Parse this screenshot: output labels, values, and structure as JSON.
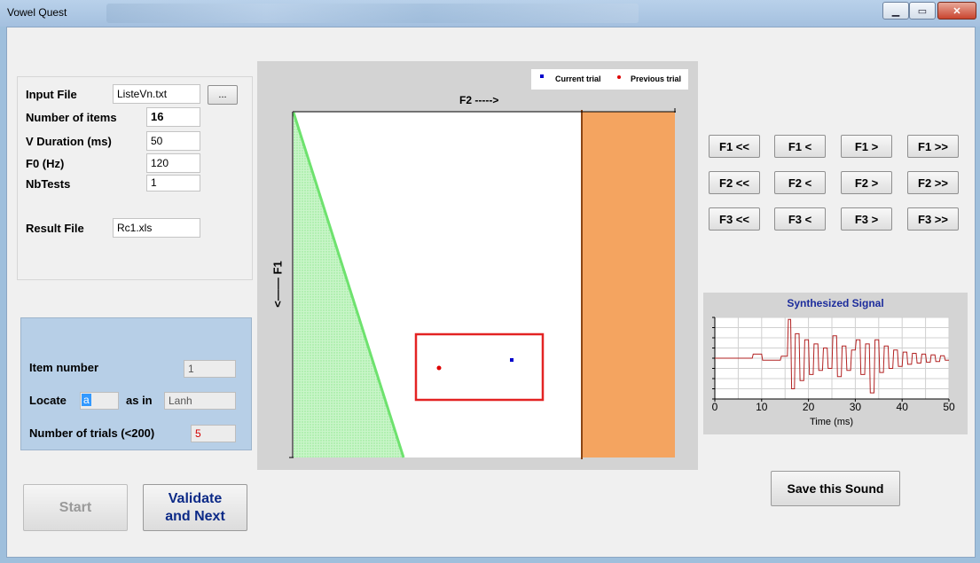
{
  "window": {
    "title": "Vowel Quest",
    "minimize_icon": "minimize-icon",
    "maximize_icon": "maximize-icon",
    "close_icon": "close-icon"
  },
  "inputs": {
    "input_file_label": "Input File",
    "input_file_value": "ListeVn.txt",
    "browse_label": "...",
    "num_items_label": "Number of items",
    "num_items_value": "16",
    "v_duration_label": "V Duration (ms)",
    "v_duration_value": "50",
    "f0_label": "F0 (Hz)",
    "f0_value": "120",
    "nbtests_label": "NbTests",
    "nbtests_value": "1",
    "result_file_label": "Result File",
    "result_file_value": "Rc1.xls"
  },
  "item": {
    "item_number_label": "Item number",
    "item_number_value": "1",
    "locate_label": "Locate",
    "locate_value": "a",
    "as_in_label": "as in",
    "as_in_value": "Lanh",
    "trials_label": "Number of trials (<200)",
    "trials_value": "5"
  },
  "buttons": {
    "start": "Start",
    "validate_line1": "Validate",
    "validate_line2": "and Next",
    "save_sound": "Save this Sound"
  },
  "plot": {
    "f2_label": "F2 ----->",
    "f1_label": "<—— F1",
    "legend_current": "Current trial",
    "legend_previous": "Previous trial",
    "current_color": "#0000cc",
    "previous_color": "#dd0000"
  },
  "formant_buttons": [
    [
      "F1 <<",
      "F1 <",
      "F1 >",
      "F1 >>"
    ],
    [
      "F2 <<",
      "F2 <",
      "F2 >",
      "F2 >>"
    ],
    [
      "F3 <<",
      "F3 <",
      "F3 >",
      "F3 >>"
    ]
  ],
  "signal": {
    "title": "Synthesized Signal",
    "xlabel": "Time (ms)",
    "xticks": [
      "0",
      "10",
      "20",
      "30",
      "40",
      "50"
    ]
  },
  "chart_data": {
    "type": "line",
    "title": "Synthesized Signal",
    "xlabel": "Time (ms)",
    "ylabel": "",
    "xlim": [
      0,
      50
    ],
    "ylim": [
      -1,
      1
    ],
    "series": [
      {
        "x": [
          0,
          8,
          8.2,
          10,
          10.2,
          14,
          14.2,
          15.5,
          15.7,
          16.2,
          16.4,
          17,
          17.2,
          18,
          18.2,
          19,
          19.2,
          20,
          20.2,
          21,
          21.2,
          22,
          22.2,
          23,
          23.2,
          24,
          24.2,
          25,
          25.2,
          26,
          26.2,
          27,
          27.2,
          28,
          28.2,
          29,
          29.2,
          30,
          30.2,
          31,
          31.2,
          32,
          32.2,
          33,
          33.2,
          34,
          34.2,
          35,
          35.2,
          36,
          36.2,
          37,
          37.2,
          38,
          38.2,
          39,
          39.2,
          40,
          40.2,
          41,
          41.2,
          42,
          42.2,
          43,
          43.2,
          44,
          44.2,
          45,
          45.2,
          46,
          46.2,
          47,
          47.2,
          48,
          48.2,
          49,
          49.2,
          50
        ],
        "y": [
          0,
          0,
          0.1,
          0.1,
          -0.05,
          -0.05,
          0.05,
          0.05,
          0.95,
          0.95,
          -0.75,
          -0.75,
          0.6,
          0.6,
          -0.55,
          -0.55,
          0.45,
          0.45,
          -0.4,
          -0.4,
          0.35,
          0.35,
          -0.3,
          -0.3,
          0.25,
          0.25,
          -0.25,
          -0.25,
          0.55,
          0.55,
          -0.45,
          -0.45,
          0.3,
          0.3,
          -0.3,
          -0.3,
          0.2,
          0.2,
          0.45,
          0.45,
          -0.4,
          -0.4,
          0.35,
          0.35,
          -0.85,
          -0.85,
          0.45,
          0.45,
          -0.35,
          -0.35,
          0.3,
          0.3,
          -0.25,
          -0.25,
          0.2,
          0.2,
          -0.2,
          -0.2,
          0.15,
          0.15,
          -0.15,
          -0.15,
          0.12,
          0.12,
          -0.12,
          -0.12,
          0.1,
          0.1,
          -0.1,
          -0.1,
          0.08,
          0.08,
          -0.08,
          -0.08,
          0.06,
          0.06,
          -0.05,
          -0.05
        ]
      }
    ]
  }
}
